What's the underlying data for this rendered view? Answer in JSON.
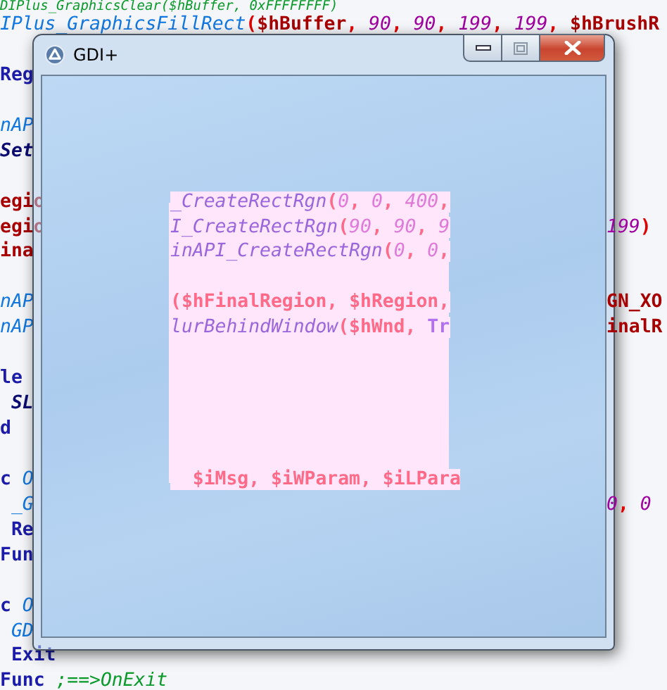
{
  "editor": {
    "lines": [
      {
        "kind": "code",
        "full": [
          {
            "text": "DIPlus_GraphicsClear($hBuffer, 0xFFFFFFFF)",
            "kind": "comment"
          }
        ]
      },
      {
        "kind": "code",
        "full": [
          {
            "text": "IPlus_GraphicsFillRect",
            "kind": "func"
          },
          {
            "text": "(",
            "kind": "punct"
          },
          {
            "text": "$hBuffer",
            "kind": "var"
          },
          {
            "text": ", ",
            "kind": "punct"
          },
          {
            "text": "90",
            "kind": "num"
          },
          {
            "text": ", ",
            "kind": "punct"
          },
          {
            "text": "90",
            "kind": "num"
          },
          {
            "text": ", ",
            "kind": "punct"
          },
          {
            "text": "199",
            "kind": "num"
          },
          {
            "text": ", ",
            "kind": "punct"
          },
          {
            "text": "199",
            "kind": "num"
          },
          {
            "text": ", ",
            "kind": "punct"
          },
          {
            "text": "$hBrushR",
            "kind": "var"
          }
        ]
      },
      {
        "kind": "blank"
      },
      {
        "kind": "code",
        "left": [
          {
            "text": "Reg",
            "kind": "keyword"
          }
        ]
      },
      {
        "kind": "blank"
      },
      {
        "kind": "code",
        "left": [
          {
            "text": "nAP",
            "kind": "func"
          }
        ]
      },
      {
        "kind": "code",
        "left": [
          {
            "text": "Set",
            "kind": "udf"
          }
        ]
      },
      {
        "kind": "blank"
      },
      {
        "kind": "code",
        "left": [
          {
            "text": "egio",
            "kind": "var"
          }
        ],
        "center": [
          {
            "text": "_CreateRectRgn",
            "kind": "func"
          },
          {
            "text": "(",
            "kind": "punct"
          },
          {
            "text": "0",
            "kind": "num"
          },
          {
            "text": ", ",
            "kind": "punct"
          },
          {
            "text": "0",
            "kind": "num"
          },
          {
            "text": ", ",
            "kind": "punct"
          },
          {
            "text": "400",
            "kind": "num"
          },
          {
            "text": ",",
            "kind": "punct"
          }
        ]
      },
      {
        "kind": "code",
        "left": [
          {
            "text": "egio",
            "kind": "var"
          }
        ],
        "center": [
          {
            "text": "I_CreateRectRgn",
            "kind": "func"
          },
          {
            "text": "(",
            "kind": "punct"
          },
          {
            "text": "90",
            "kind": "num"
          },
          {
            "text": ", ",
            "kind": "punct"
          },
          {
            "text": "90",
            "kind": "num"
          },
          {
            "text": ", ",
            "kind": "punct"
          },
          {
            "text": "9",
            "kind": "num"
          }
        ],
        "right": [
          {
            "text": "199",
            "kind": "num"
          },
          {
            "text": ")",
            "kind": "punct"
          }
        ]
      },
      {
        "kind": "code",
        "left": [
          {
            "text": "ina",
            "kind": "var"
          }
        ],
        "center": [
          {
            "text": "inAPI_CreateRectRgn",
            "kind": "func"
          },
          {
            "text": "(",
            "kind": "punct"
          },
          {
            "text": "0",
            "kind": "num"
          },
          {
            "text": ", ",
            "kind": "punct"
          },
          {
            "text": "0",
            "kind": "num"
          },
          {
            "text": ",",
            "kind": "punct"
          }
        ]
      },
      {
        "kind": "blank"
      },
      {
        "kind": "code",
        "left": [
          {
            "text": "nAP",
            "kind": "func"
          }
        ],
        "center": [
          {
            "text": "(",
            "kind": "punct"
          },
          {
            "text": "$hFinalRegion",
            "kind": "var"
          },
          {
            "text": ", ",
            "kind": "punct"
          },
          {
            "text": "$hRegion",
            "kind": "var"
          },
          {
            "text": ",",
            "kind": "punct"
          }
        ],
        "right": [
          {
            "text": "GN_XO",
            "kind": "var"
          }
        ]
      },
      {
        "kind": "code",
        "left": [
          {
            "text": "nAP",
            "kind": "func"
          }
        ],
        "center": [
          {
            "text": "lurBehindWindow",
            "kind": "func"
          },
          {
            "text": "(",
            "kind": "punct"
          },
          {
            "text": "$hWnd",
            "kind": "var"
          },
          {
            "text": ", ",
            "kind": "punct"
          },
          {
            "text": "Tr",
            "kind": "keyword"
          }
        ],
        "right": [
          {
            "text": "inalR",
            "kind": "var"
          }
        ]
      },
      {
        "kind": "blank"
      },
      {
        "kind": "code",
        "left": [
          {
            "text": "le",
            "kind": "keyword"
          }
        ]
      },
      {
        "kind": "code",
        "left": [
          {
            "text": " SL",
            "kind": "udf"
          }
        ]
      },
      {
        "kind": "code",
        "left": [
          {
            "text": "d",
            "kind": "keyword"
          }
        ]
      },
      {
        "kind": "blank"
      },
      {
        "kind": "code",
        "left": [
          {
            "text": "c",
            "kind": "keyword"
          },
          {
            "text": " O",
            "kind": "func"
          }
        ],
        "center": [
          {
            "text": "  $iMsg",
            "kind": "var"
          },
          {
            "text": ", ",
            "kind": "punct"
          },
          {
            "text": "$iWParam",
            "kind": "var"
          },
          {
            "text": ", ",
            "kind": "punct"
          },
          {
            "text": "$iLPara",
            "kind": "var"
          }
        ]
      },
      {
        "kind": "code",
        "left": [
          {
            "text": " _G",
            "kind": "func"
          }
        ],
        "right": [
          {
            "text": "0",
            "kind": "num"
          },
          {
            "text": ", ",
            "kind": "punct"
          },
          {
            "text": "0",
            "kind": "num"
          }
        ]
      },
      {
        "kind": "code",
        "left": [
          {
            "text": " Re",
            "kind": "keyword"
          }
        ]
      },
      {
        "kind": "code",
        "left": [
          {
            "text": "Fun",
            "kind": "keyword"
          }
        ]
      },
      {
        "kind": "blank"
      },
      {
        "kind": "code",
        "left": [
          {
            "text": "c",
            "kind": "keyword"
          },
          {
            "text": " O",
            "kind": "func"
          }
        ]
      },
      {
        "kind": "code",
        "left": [
          {
            "text": " GD",
            "kind": "func"
          }
        ]
      },
      {
        "kind": "code",
        "full": [
          {
            "text": " Exit",
            "kind": "keyword"
          }
        ]
      },
      {
        "kind": "code",
        "full": [
          {
            "text": "Func",
            "kind": "keyword"
          },
          {
            "text": " ;==>OnExit",
            "kind": "comment"
          }
        ]
      }
    ]
  },
  "window": {
    "title": "GDI+",
    "buttons": [
      {
        "kind": "minimize"
      },
      {
        "kind": "maximize"
      },
      {
        "kind": "close"
      }
    ]
  }
}
